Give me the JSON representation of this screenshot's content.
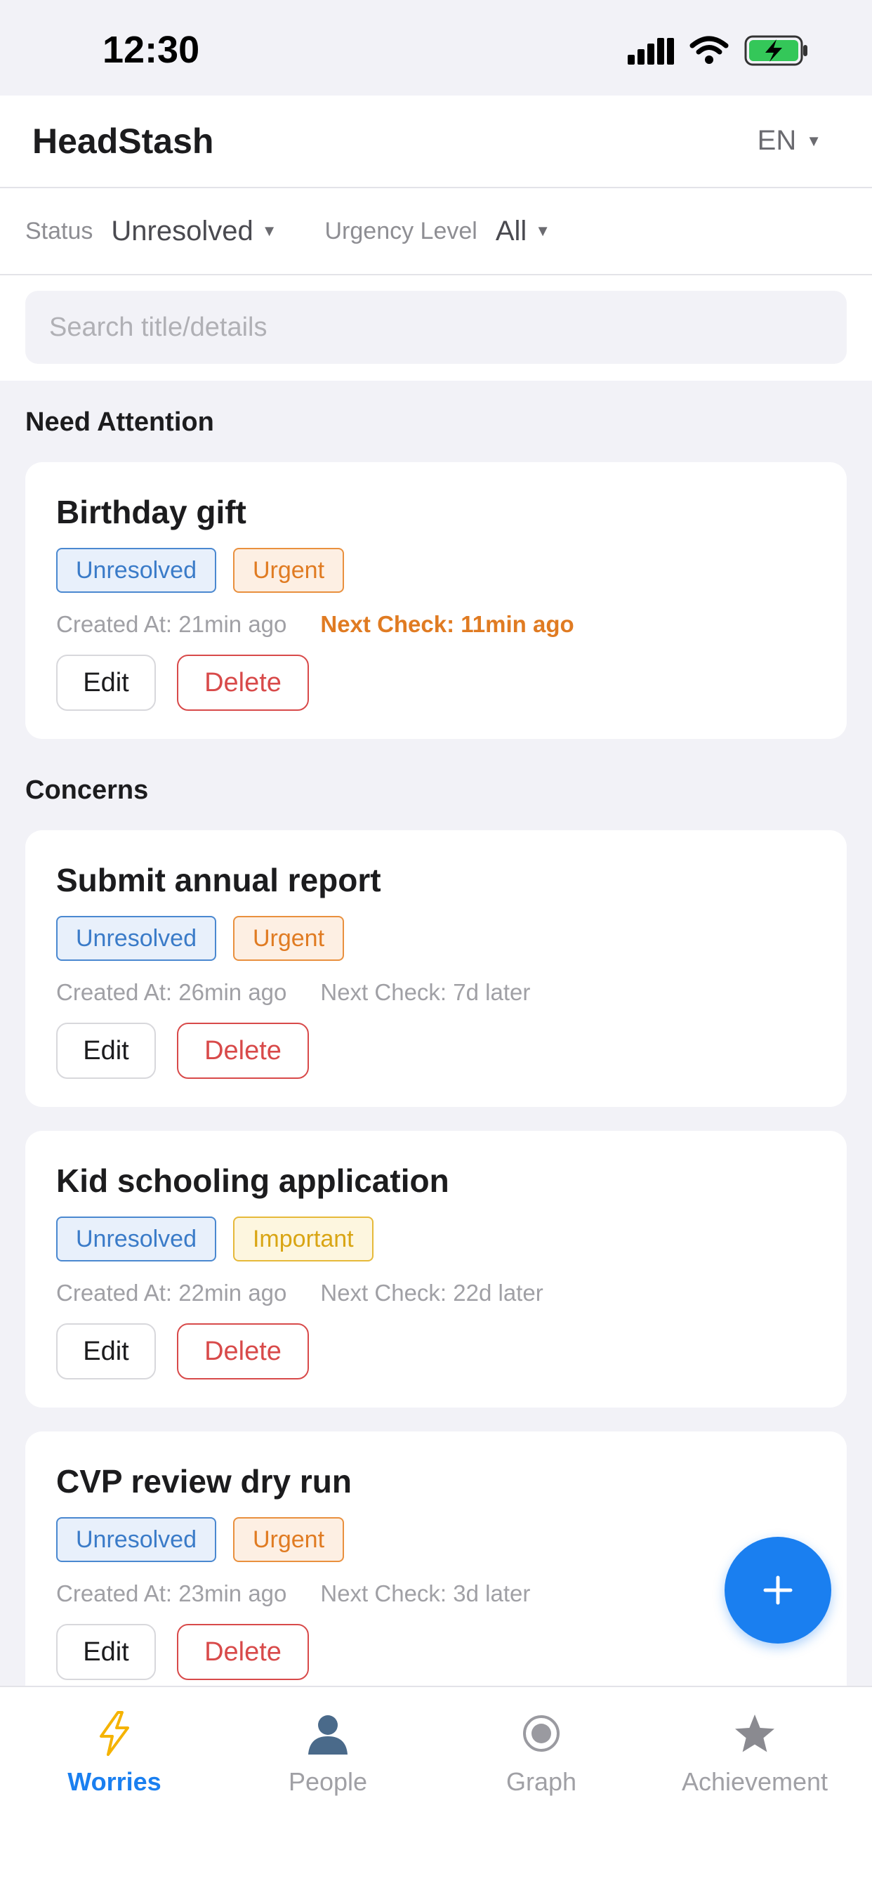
{
  "status_bar": {
    "time": "12:30"
  },
  "header": {
    "title": "HeadStash",
    "language": "EN"
  },
  "filters": {
    "status_label": "Status",
    "status_value": "Unresolved",
    "urgency_label": "Urgency Level",
    "urgency_value": "All"
  },
  "search": {
    "placeholder": "Search title/details",
    "value": ""
  },
  "sections": {
    "attention": "Need Attention",
    "concerns": "Concerns"
  },
  "cards": [
    {
      "title": "Birthday gift",
      "status": "Unresolved",
      "level": "Urgent",
      "created": "Created At: 21min ago",
      "next_check": "Next Check: 11min ago",
      "edit": "Edit",
      "delete": "Delete"
    },
    {
      "title": "Submit annual report",
      "status": "Unresolved",
      "level": "Urgent",
      "created": "Created At: 26min ago",
      "next_check": "Next Check: 7d later",
      "edit": "Edit",
      "delete": "Delete"
    },
    {
      "title": "Kid schooling application",
      "status": "Unresolved",
      "level": "Important",
      "created": "Created At: 22min ago",
      "next_check": "Next Check: 22d later",
      "edit": "Edit",
      "delete": "Delete"
    },
    {
      "title": "CVP review dry run",
      "status": "Unresolved",
      "level": "Urgent",
      "created": "Created At: 23min ago",
      "next_check": "Next Check: 3d later",
      "edit": "Edit",
      "delete": "Delete"
    }
  ],
  "tabs": [
    {
      "label": "Worries",
      "icon": "lightning-icon",
      "active": true
    },
    {
      "label": "People",
      "icon": "person-icon"
    },
    {
      "label": "Graph",
      "icon": "radio-icon"
    },
    {
      "label": "Achievement",
      "icon": "star-icon"
    }
  ],
  "colors": {
    "accent": "#1A7FF0",
    "urgent": "#E07B22",
    "important": "#D9A514",
    "unresolved": "#3A7BC8",
    "danger": "#D84A4A"
  }
}
